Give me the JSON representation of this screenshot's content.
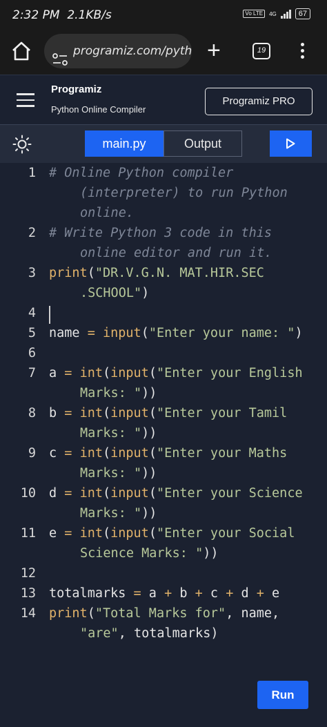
{
  "status_bar": {
    "time": "2:32 PM",
    "speed": "2.1KB/s",
    "volte": "Vo LTE",
    "network": "4G",
    "battery": "67"
  },
  "browser": {
    "url": "programiz.com/python-p",
    "tab_count": "19"
  },
  "header": {
    "logo": "Programiz",
    "subtitle": "Python Online Compiler",
    "pro_button": "Programiz PRO"
  },
  "toolbar": {
    "tabs": [
      "main.py",
      "Output"
    ],
    "active_tab": "main.py"
  },
  "editor": {
    "line_numbers": [
      "1",
      "2",
      "3",
      "4",
      "5",
      "6",
      "7",
      "8",
      "9",
      "10",
      "11",
      "12",
      "13",
      "14"
    ],
    "active_line": "4"
  },
  "run_button": "Run",
  "colors": {
    "accent": "#1d64f2",
    "background": "#1b2130",
    "toolbar": "#252c3c",
    "string": "#b8c99a",
    "keyword": "#e2b36a",
    "comment": "#7e8697"
  },
  "icons": [
    "home-icon",
    "site-settings-icon",
    "new-tab-icon",
    "tab-switcher-icon",
    "more-menu-icon",
    "hamburger-icon",
    "theme-sun-icon",
    "play-icon"
  ]
}
